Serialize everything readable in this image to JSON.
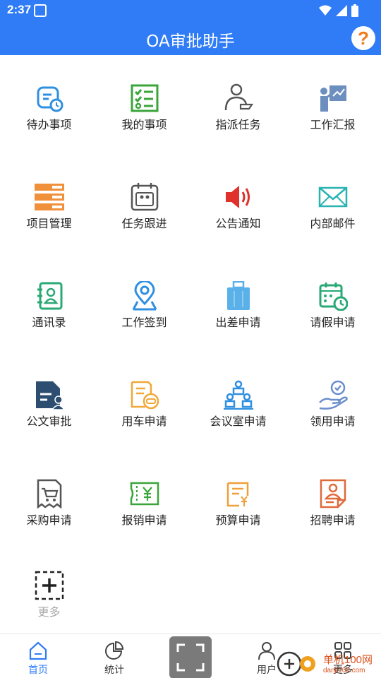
{
  "status": {
    "time": "2:37"
  },
  "header": {
    "title": "OA审批助手",
    "help_icon": "?"
  },
  "grid": {
    "items": [
      {
        "label": "待办事项",
        "icon": "todo-clock-icon"
      },
      {
        "label": "我的事项",
        "icon": "checklist-icon"
      },
      {
        "label": "指派任务",
        "icon": "assign-person-icon"
      },
      {
        "label": "工作汇报",
        "icon": "report-presenter-icon"
      },
      {
        "label": "项目管理",
        "icon": "project-bars-icon"
      },
      {
        "label": "任务跟进",
        "icon": "task-calendar-icon"
      },
      {
        "label": "公告通知",
        "icon": "megaphone-icon"
      },
      {
        "label": "内部邮件",
        "icon": "mail-icon"
      },
      {
        "label": "通讯录",
        "icon": "contacts-book-icon"
      },
      {
        "label": "工作签到",
        "icon": "location-pin-icon"
      },
      {
        "label": "出差申请",
        "icon": "luggage-icon"
      },
      {
        "label": "请假申请",
        "icon": "leave-calendar-icon"
      },
      {
        "label": "公文审批",
        "icon": "document-user-icon"
      },
      {
        "label": "用车申请",
        "icon": "car-form-icon"
      },
      {
        "label": "会议室申请",
        "icon": "meeting-room-icon"
      },
      {
        "label": "领用申请",
        "icon": "hand-check-icon"
      },
      {
        "label": "采购申请",
        "icon": "shopping-cart-doc-icon"
      },
      {
        "label": "报销申请",
        "icon": "yuan-ticket-icon"
      },
      {
        "label": "预算申请",
        "icon": "budget-doc-icon"
      },
      {
        "label": "招聘申请",
        "icon": "recruit-profile-icon"
      }
    ],
    "more_label": "更多"
  },
  "bottom_nav": {
    "home": "首页",
    "stats": "统计",
    "user": "用户",
    "more": "更多"
  },
  "watermark": {
    "text": "单机100网",
    "sub": "danji100.com"
  },
  "colors": {
    "primary": "#2f7cf6",
    "accent": "#f07a1a"
  }
}
